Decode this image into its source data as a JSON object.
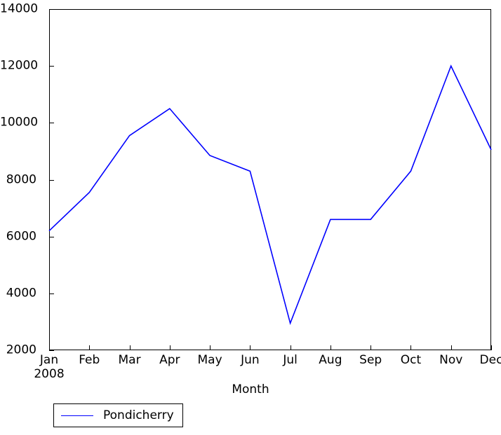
{
  "chart_data": {
    "type": "line",
    "title": "",
    "subtitle": "",
    "xlabel": "Month",
    "ylabel": "",
    "categories": [
      "Jan",
      "Feb",
      "Mar",
      "Apr",
      "May",
      "Jun",
      "Jul",
      "Aug",
      "Sep",
      "Oct",
      "Nov",
      "Dec"
    ],
    "x_sub_labels": {
      "Jan": "2008"
    },
    "series": [
      {
        "name": "Pondicherry",
        "color": "#0000ff",
        "values": [
          6200,
          7550,
          9550,
          10500,
          8850,
          8300,
          2950,
          6600,
          6600,
          8300,
          12000,
          9050
        ]
      }
    ],
    "ylim": [
      2000,
      14000
    ],
    "y_ticks": [
      2000,
      4000,
      6000,
      8000,
      10000,
      12000,
      14000
    ],
    "y_tick_labels": [
      "2000",
      "4000",
      "6000",
      "8000",
      "10000",
      "12000",
      "14000"
    ],
    "xlim_categories": [
      "Jan",
      "Dec"
    ],
    "grid": false,
    "legend": {
      "position": "below-left",
      "entries": [
        {
          "label": "Pondicherry",
          "color": "#0000ff",
          "marker": "line"
        }
      ]
    },
    "colors": {
      "line": "#0000ff",
      "axis": "#000000",
      "background": "#ffffff"
    }
  }
}
